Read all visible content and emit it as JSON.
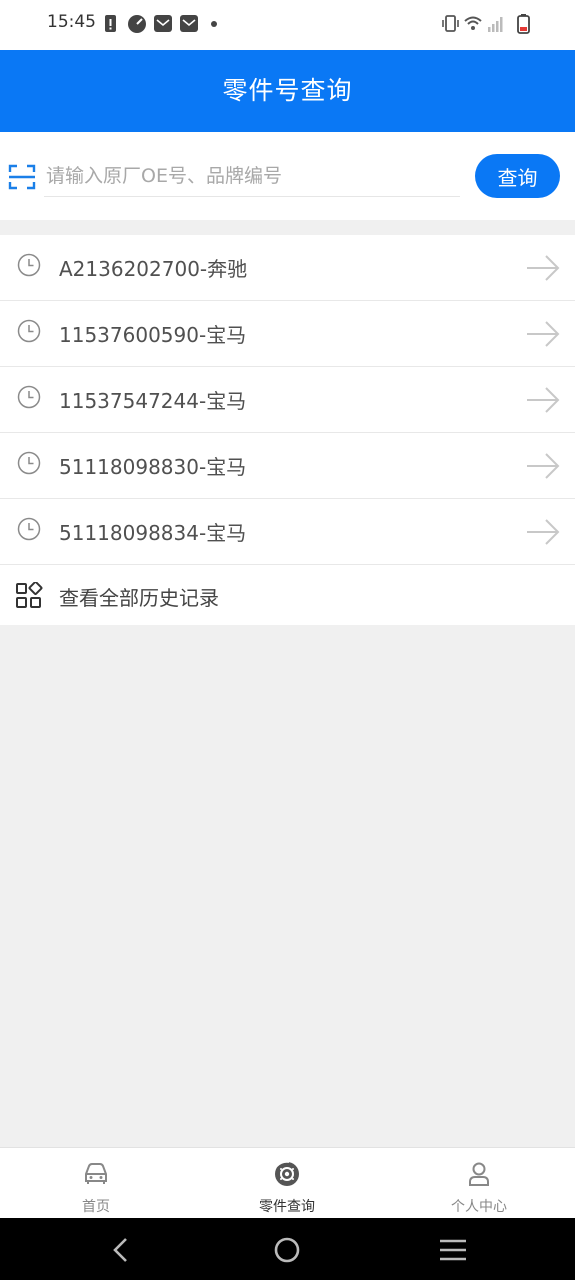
{
  "status_bar": {
    "time": "15:45",
    "icons": [
      "battery-alert-icon",
      "gauge-icon",
      "mail-icon",
      "mail-icon",
      "dot-icon",
      "vibrate-icon",
      "wifi-icon",
      "signal-icon",
      "battery-icon"
    ]
  },
  "app_bar": {
    "title": "零件号查询"
  },
  "search": {
    "placeholder": "请输入原厂OE号、品牌编号",
    "value": "",
    "button_label": "查询",
    "scan_icon": "scan-icon"
  },
  "history": {
    "items": [
      {
        "label": "A2136202700-奔驰"
      },
      {
        "label": "11537600590-宝马"
      },
      {
        "label": "11537547244-宝马"
      },
      {
        "label": "51118098830-宝马"
      },
      {
        "label": "51118098834-宝马"
      }
    ],
    "view_all_label": "查看全部历史记录"
  },
  "bottom_nav": {
    "tabs": [
      {
        "label": "首页",
        "icon": "car-icon"
      },
      {
        "label": "零件查询",
        "icon": "brake-disc-icon",
        "active": true
      },
      {
        "label": "个人中心",
        "icon": "user-icon"
      }
    ]
  },
  "colors": {
    "primary": "#0a78f5",
    "background": "#f0f0f0",
    "text": "#505050",
    "system_nav": "#000000"
  }
}
